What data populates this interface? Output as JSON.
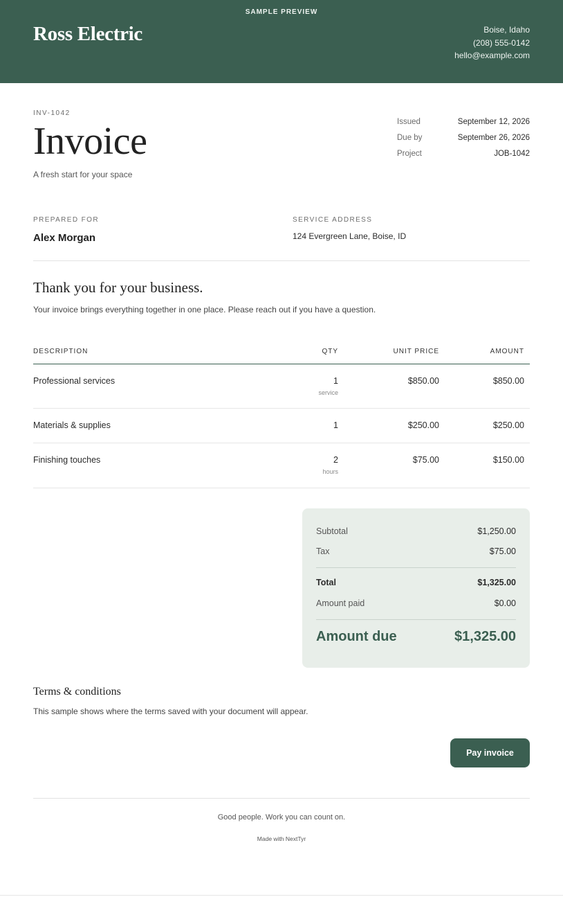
{
  "header": {
    "preview_tag": "SAMPLE PREVIEW",
    "company": "Ross Electric",
    "location": "Boise, Idaho",
    "phone": "(208) 555-0142",
    "email": "hello@example.com",
    "color": "#3b5f51"
  },
  "invoice": {
    "number": "INV-1042",
    "title": "Invoice",
    "tagline": "A fresh start for your space",
    "meta": [
      {
        "label": "Issued",
        "value": "September 12, 2026"
      },
      {
        "label": "Due by",
        "value": "September 26, 2026"
      },
      {
        "label": "Project",
        "value": "JOB-1042"
      }
    ]
  },
  "parties": {
    "prepared_label": "PREPARED FOR",
    "prepared_name": "Alex Morgan",
    "service_label": "SERVICE ADDRESS",
    "service_address": "124 Evergreen Lane, Boise, ID"
  },
  "thanks": {
    "title": "Thank you for your business.",
    "text": "Your invoice brings everything together in one place. Please reach out if you have a question."
  },
  "table": {
    "headers": {
      "description": "DESCRIPTION",
      "qty": "QTY",
      "unit_price": "UNIT PRICE",
      "amount": "AMOUNT"
    },
    "rows": [
      {
        "description": "Professional services",
        "qty": "1",
        "unit": "service",
        "unit_price": "$850.00",
        "amount": "$850.00"
      },
      {
        "description": "Materials & supplies",
        "qty": "1",
        "unit": "",
        "unit_price": "$250.00",
        "amount": "$250.00"
      },
      {
        "description": "Finishing touches",
        "qty": "2",
        "unit": "hours",
        "unit_price": "$75.00",
        "amount": "$150.00"
      }
    ]
  },
  "totals": {
    "subtotal_label": "Subtotal",
    "subtotal": "$1,250.00",
    "tax_label": "Tax",
    "tax": "$75.00",
    "total_label": "Total",
    "total": "$1,325.00",
    "paid_label": "Amount paid",
    "paid": "$0.00",
    "due_label": "Amount due",
    "due": "$1,325.00"
  },
  "terms": {
    "title": "Terms & conditions",
    "text": "This sample shows where the terms saved with your document will appear."
  },
  "actions": {
    "pay_label": "Pay invoice"
  },
  "footer": {
    "motto": "Good people. Work you can count on.",
    "made_with": "Made with NextTyr"
  }
}
